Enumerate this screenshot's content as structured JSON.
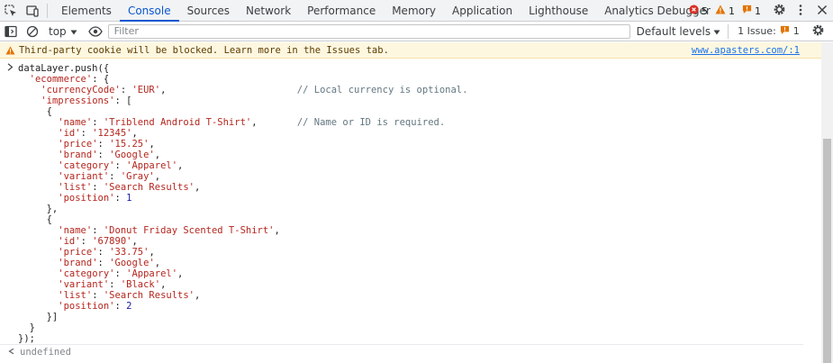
{
  "tabbar": {
    "tabs": [
      {
        "label": "Elements",
        "active": false
      },
      {
        "label": "Console",
        "active": true
      },
      {
        "label": "Sources",
        "active": false
      },
      {
        "label": "Network",
        "active": false
      },
      {
        "label": "Performance",
        "active": false
      },
      {
        "label": "Memory",
        "active": false
      },
      {
        "label": "Application",
        "active": false
      },
      {
        "label": "Lighthouse",
        "active": false
      },
      {
        "label": "Analytics Debugger",
        "active": false
      }
    ],
    "errors_count": "5",
    "warnings_count": "1",
    "issues_count": "1",
    "icons": [
      "inspect-element-icon",
      "device-toolbar-icon",
      "error-icon",
      "warning-icon",
      "issue-icon",
      "gear-icon",
      "kebab-menu-icon",
      "close-icon"
    ]
  },
  "toolbar": {
    "context": "top",
    "filter_placeholder": "Filter",
    "levels_label": "Default levels",
    "issues_label": "1 Issue:",
    "issues_count": "1"
  },
  "warning": {
    "message": "Third-party cookie will be blocked. Learn more in the Issues tab.",
    "source": "www.apasters.com/:1"
  },
  "console": {
    "lines": [
      [
        {
          "t": "plain",
          "v": "dataLayer.push({"
        }
      ],
      [
        {
          "t": "plain",
          "v": "  "
        },
        {
          "t": "str",
          "v": "'ecommerce'"
        },
        {
          "t": "plain",
          "v": ": {"
        }
      ],
      [
        {
          "t": "plain",
          "v": "    "
        },
        {
          "t": "str",
          "v": "'currencyCode'"
        },
        {
          "t": "plain",
          "v": ": "
        },
        {
          "t": "str",
          "v": "'EUR'"
        },
        {
          "t": "plain",
          "v": ",                       "
        },
        {
          "t": "cmt",
          "v": "// Local currency is optional."
        }
      ],
      [
        {
          "t": "plain",
          "v": "    "
        },
        {
          "t": "str",
          "v": "'impressions'"
        },
        {
          "t": "plain",
          "v": ": ["
        }
      ],
      [
        {
          "t": "plain",
          "v": "     {"
        }
      ],
      [
        {
          "t": "plain",
          "v": "       "
        },
        {
          "t": "str",
          "v": "'name'"
        },
        {
          "t": "plain",
          "v": ": "
        },
        {
          "t": "str",
          "v": "'Triblend Android T-Shirt'"
        },
        {
          "t": "plain",
          "v": ",       "
        },
        {
          "t": "cmt",
          "v": "// Name or ID is required."
        }
      ],
      [
        {
          "t": "plain",
          "v": "       "
        },
        {
          "t": "str",
          "v": "'id'"
        },
        {
          "t": "plain",
          "v": ": "
        },
        {
          "t": "str",
          "v": "'12345'"
        },
        {
          "t": "plain",
          "v": ","
        }
      ],
      [
        {
          "t": "plain",
          "v": "       "
        },
        {
          "t": "str",
          "v": "'price'"
        },
        {
          "t": "plain",
          "v": ": "
        },
        {
          "t": "str",
          "v": "'15.25'"
        },
        {
          "t": "plain",
          "v": ","
        }
      ],
      [
        {
          "t": "plain",
          "v": "       "
        },
        {
          "t": "str",
          "v": "'brand'"
        },
        {
          "t": "plain",
          "v": ": "
        },
        {
          "t": "str",
          "v": "'Google'"
        },
        {
          "t": "plain",
          "v": ","
        }
      ],
      [
        {
          "t": "plain",
          "v": "       "
        },
        {
          "t": "str",
          "v": "'category'"
        },
        {
          "t": "plain",
          "v": ": "
        },
        {
          "t": "str",
          "v": "'Apparel'"
        },
        {
          "t": "plain",
          "v": ","
        }
      ],
      [
        {
          "t": "plain",
          "v": "       "
        },
        {
          "t": "str",
          "v": "'variant'"
        },
        {
          "t": "plain",
          "v": ": "
        },
        {
          "t": "str",
          "v": "'Gray'"
        },
        {
          "t": "plain",
          "v": ","
        }
      ],
      [
        {
          "t": "plain",
          "v": "       "
        },
        {
          "t": "str",
          "v": "'list'"
        },
        {
          "t": "plain",
          "v": ": "
        },
        {
          "t": "str",
          "v": "'Search Results'"
        },
        {
          "t": "plain",
          "v": ","
        }
      ],
      [
        {
          "t": "plain",
          "v": "       "
        },
        {
          "t": "str",
          "v": "'position'"
        },
        {
          "t": "plain",
          "v": ": "
        },
        {
          "t": "num",
          "v": "1"
        }
      ],
      [
        {
          "t": "plain",
          "v": "     },"
        }
      ],
      [
        {
          "t": "plain",
          "v": "     {"
        }
      ],
      [
        {
          "t": "plain",
          "v": "       "
        },
        {
          "t": "str",
          "v": "'name'"
        },
        {
          "t": "plain",
          "v": ": "
        },
        {
          "t": "str",
          "v": "'Donut Friday Scented T-Shirt'"
        },
        {
          "t": "plain",
          "v": ","
        }
      ],
      [
        {
          "t": "plain",
          "v": "       "
        },
        {
          "t": "str",
          "v": "'id'"
        },
        {
          "t": "plain",
          "v": ": "
        },
        {
          "t": "str",
          "v": "'67890'"
        },
        {
          "t": "plain",
          "v": ","
        }
      ],
      [
        {
          "t": "plain",
          "v": "       "
        },
        {
          "t": "str",
          "v": "'price'"
        },
        {
          "t": "plain",
          "v": ": "
        },
        {
          "t": "str",
          "v": "'33.75'"
        },
        {
          "t": "plain",
          "v": ","
        }
      ],
      [
        {
          "t": "plain",
          "v": "       "
        },
        {
          "t": "str",
          "v": "'brand'"
        },
        {
          "t": "plain",
          "v": ": "
        },
        {
          "t": "str",
          "v": "'Google'"
        },
        {
          "t": "plain",
          "v": ","
        }
      ],
      [
        {
          "t": "plain",
          "v": "       "
        },
        {
          "t": "str",
          "v": "'category'"
        },
        {
          "t": "plain",
          "v": ": "
        },
        {
          "t": "str",
          "v": "'Apparel'"
        },
        {
          "t": "plain",
          "v": ","
        }
      ],
      [
        {
          "t": "plain",
          "v": "       "
        },
        {
          "t": "str",
          "v": "'variant'"
        },
        {
          "t": "plain",
          "v": ": "
        },
        {
          "t": "str",
          "v": "'Black'"
        },
        {
          "t": "plain",
          "v": ","
        }
      ],
      [
        {
          "t": "plain",
          "v": "       "
        },
        {
          "t": "str",
          "v": "'list'"
        },
        {
          "t": "plain",
          "v": ": "
        },
        {
          "t": "str",
          "v": "'Search Results'"
        },
        {
          "t": "plain",
          "v": ","
        }
      ],
      [
        {
          "t": "plain",
          "v": "       "
        },
        {
          "t": "str",
          "v": "'position'"
        },
        {
          "t": "plain",
          "v": ": "
        },
        {
          "t": "num",
          "v": "2"
        }
      ],
      [
        {
          "t": "plain",
          "v": "     }]"
        }
      ],
      [
        {
          "t": "plain",
          "v": "  }"
        }
      ],
      [
        {
          "t": "plain",
          "v": "});"
        }
      ]
    ],
    "result_value": "undefined"
  },
  "colors": {
    "accent": "#0b57d0",
    "error": "#d93025",
    "warning": "#e37400",
    "warning_bg": "#fef7e0",
    "string": "#b5261e",
    "number": "#1a1aa6",
    "comment": "#637780"
  }
}
